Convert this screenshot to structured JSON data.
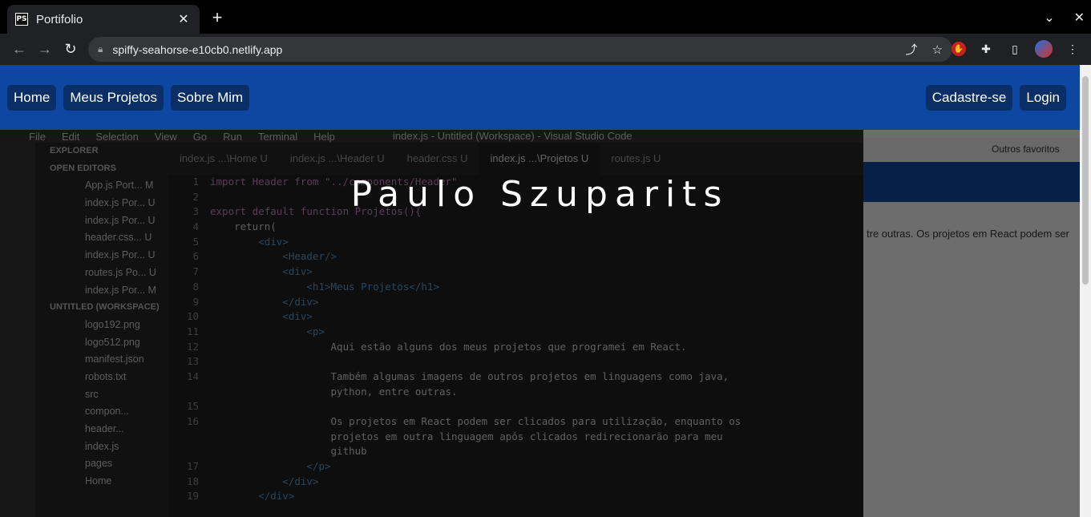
{
  "browser": {
    "tab_title": "Portifolio",
    "tab_favicon": "PS",
    "url": "spiffy-seahorse-e10cb0.netlify.app"
  },
  "nav": {
    "left": [
      "Home",
      "Meus Projetos",
      "Sobre Mim"
    ],
    "right": [
      "Cadastre-se",
      "Login"
    ]
  },
  "hero": {
    "title": "Paulo Szuparits"
  },
  "background_image": {
    "menu": [
      "File",
      "Edit",
      "Selection",
      "View",
      "Go",
      "Run",
      "Terminal",
      "Help"
    ],
    "window_title": "index.js - Untitled (Workspace) - Visual Studio Code",
    "tabs": [
      "index.js ...\\Home U",
      "index.js ...\\Header U",
      "header.css U",
      "index.js ...\\Projetos U",
      "routes.js U"
    ],
    "sidebar": [
      "EXPLORER",
      "OPEN EDITORS",
      "App.js Port... M",
      "index.js Por... U",
      "index.js Por... U",
      "header.css... U",
      "index.js Por... U",
      "routes.js Po... U",
      "index.js Por... M",
      "UNTITLED (WORKSPACE)",
      "logo192.png",
      "logo512.png",
      "manifest.json",
      "robots.txt",
      "src",
      "compon...",
      "header...",
      "index.js",
      "pages",
      "Home"
    ],
    "code": [
      {
        "n": "1",
        "t": "import Header from \"../components/Header\""
      },
      {
        "n": "2",
        "t": ""
      },
      {
        "n": "3",
        "t": "export default function Projetos(){"
      },
      {
        "n": "4",
        "t": "    return("
      },
      {
        "n": "5",
        "t": "        <div>"
      },
      {
        "n": "6",
        "t": "            <Header/>"
      },
      {
        "n": "7",
        "t": "            <div>"
      },
      {
        "n": "8",
        "t": "                <h1>Meus Projetos</h1>"
      },
      {
        "n": "9",
        "t": "            </div>"
      },
      {
        "n": "10",
        "t": "            <div>"
      },
      {
        "n": "11",
        "t": "                <p>"
      },
      {
        "n": "12",
        "t": "                    Aqui estão alguns dos meus projetos que programei em React."
      },
      {
        "n": "13",
        "t": ""
      },
      {
        "n": "14",
        "t": "                    Também algumas imagens de outros projetos em linguagens como java,"
      },
      {
        "n": "",
        "t": "                    python, entre outras."
      },
      {
        "n": "15",
        "t": ""
      },
      {
        "n": "16",
        "t": "                    Os projetos em React podem ser clicados para utilização, enquanto os"
      },
      {
        "n": "",
        "t": "                    projetos em outra linguagem após clicados redirecionarão para meu"
      },
      {
        "n": "",
        "t": "                    github"
      },
      {
        "n": "17",
        "t": "                </p>"
      },
      {
        "n": "18",
        "t": "            </div>"
      },
      {
        "n": "19",
        "t": "        </div>"
      }
    ],
    "right_panel_text": "tre outras. Os projetos em React podem ser",
    "right_panel_fav": "Outros favoritos"
  }
}
